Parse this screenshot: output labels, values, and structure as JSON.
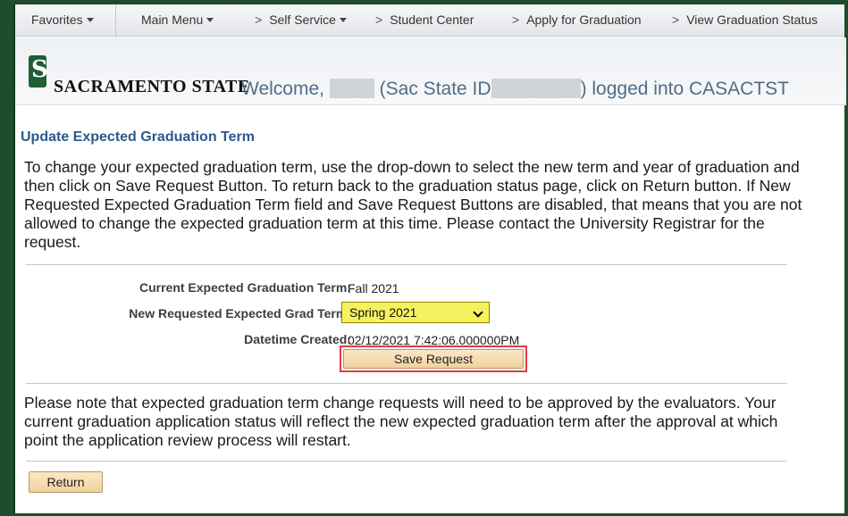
{
  "nav": {
    "favorites": "Favorites",
    "main_menu": "Main Menu",
    "self_service": "Self Service",
    "student_center": "Student Center",
    "apply_graduation": "Apply for Graduation",
    "view_status": "View Graduation Status",
    "separator": ">"
  },
  "header": {
    "logo_letter": "S",
    "logo_text": "SACRAMENTO STATE",
    "welcome_prefix": "Welcome,",
    "welcome_mid": "(Sac State ID",
    "welcome_suffix": ") logged into CASACTST"
  },
  "page": {
    "title": "Update Expected Graduation Term",
    "instructions": "To change your expected graduation term, use the drop-down to select the new term and year of graduation and then click on Save Request Button. To return back to the graduation status page, click on Return button. If New Requested Expected Graduation Term field and Save Request Buttons are disabled, that means that you are not allowed to change the expected graduation term at this time. Please contact the University Registrar for the request.",
    "note": "Please note that expected graduation term change requests will need to be approved by the evaluators. Your current graduation application status will reflect the new expected graduation term after the approval at which point the application review process will restart."
  },
  "form": {
    "current_label": "Current Expected Graduation Term:",
    "current_value": "Fall 2021",
    "new_label": "New Requested Expected Grad Term:",
    "new_value": "Spring 2021",
    "created_label": "Datetime Created:",
    "created_value": "02/12/2021  7:42:06.000000PM"
  },
  "buttons": {
    "save": "Save Request",
    "return": "Return"
  },
  "colors": {
    "frame_green": "#1f4d2c",
    "title_blue": "#2c5a8c",
    "select_highlight": "#f6f15e",
    "save_outline": "#e23b42",
    "button_fill": "#f1d29f"
  }
}
